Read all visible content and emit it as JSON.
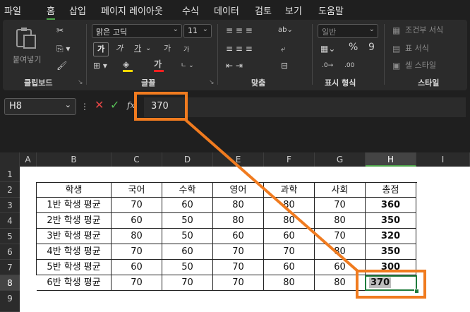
{
  "menu": [
    "파일",
    "홈",
    "삽입",
    "페이지 레이아웃",
    "수식",
    "데이터",
    "검토",
    "보기",
    "도움말"
  ],
  "ribbon": {
    "paste_label": "붙여넣기",
    "font_name": "맑은 고딕",
    "font_size": "11",
    "number_format": "일반",
    "groups": [
      "클립보드",
      "글꼴",
      "맞춤",
      "표시 형식",
      "스타일"
    ],
    "styles": [
      "조건부 서식",
      "표 서식",
      "셀 스타일"
    ],
    "bold_glyph": "가",
    "italic_glyph": "가",
    "underline_glyph": "가",
    "grow_glyph": "가",
    "shrink_glyph": "가",
    "accent_color": "#4ea64a",
    "highlight_color": "#ffd700",
    "font_color": "#ff2020"
  },
  "formula_bar": {
    "name_box": "H8",
    "fx": "fx",
    "value": "370"
  },
  "columns": [
    "A",
    "B",
    "C",
    "D",
    "E",
    "F",
    "G",
    "H",
    "I"
  ],
  "rows": [
    "1",
    "2",
    "3",
    "4",
    "5",
    "6",
    "7",
    "8",
    "9"
  ],
  "table": {
    "headers": [
      "학생",
      "국어",
      "수학",
      "영어",
      "과학",
      "사회",
      "총점"
    ],
    "data": [
      [
        "1반 학생 평균",
        "70",
        "60",
        "80",
        "80",
        "70",
        "360"
      ],
      [
        "2반 학생 평균",
        "60",
        "50",
        "80",
        "80",
        "80",
        "350"
      ],
      [
        "3반 학생 평균",
        "80",
        "50",
        "60",
        "60",
        "70",
        "320"
      ],
      [
        "4반 학생 평균",
        "70",
        "60",
        "70",
        "70",
        "80",
        "350"
      ],
      [
        "5반 학생 평균",
        "60",
        "50",
        "70",
        "60",
        "60",
        "300"
      ],
      [
        "6반 학생 평균",
        "70",
        "70",
        "70",
        "80",
        "80",
        "370"
      ]
    ]
  },
  "annotation_color": "#f07b1f"
}
